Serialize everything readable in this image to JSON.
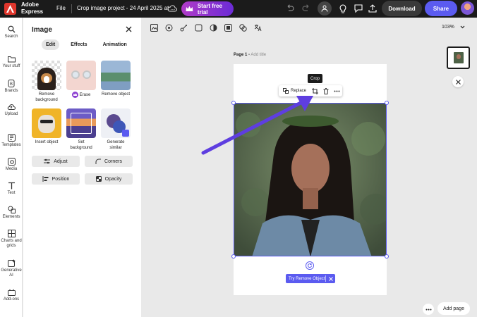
{
  "app": {
    "brand_line1": "Adobe",
    "brand_line2": "Express"
  },
  "topbar": {
    "file": "File",
    "title": "Crop image project - 24 April 2025 at ...",
    "trial": "Start free trial",
    "download": "Download",
    "share": "Share"
  },
  "rail": [
    {
      "label": "Search",
      "icon": "search-icon"
    },
    {
      "label": "Your stuff",
      "icon": "folder-icon"
    },
    {
      "label": "Brands",
      "icon": "brand-icon"
    },
    {
      "label": "Upload",
      "icon": "upload-icon"
    },
    {
      "label": "Templates",
      "icon": "templates-icon"
    },
    {
      "label": "Media",
      "icon": "media-icon"
    },
    {
      "label": "Text",
      "icon": "text-icon"
    },
    {
      "label": "Elements",
      "icon": "elements-icon"
    },
    {
      "label": "Charts and",
      "label2": "grids",
      "icon": "charts-icon"
    },
    {
      "label": "Generative",
      "label2": "AI",
      "icon": "generative-ai-icon"
    },
    {
      "label": "Add-ons",
      "icon": "addons-icon"
    }
  ],
  "panel": {
    "title": "Image",
    "tabs": [
      "Edit",
      "Effects",
      "Animation"
    ],
    "tiles": [
      {
        "label": "Remove",
        "label2": "background"
      },
      {
        "label": "Erase"
      },
      {
        "label": "Remove object"
      },
      {
        "label": "Insert object"
      },
      {
        "label": "Set background"
      },
      {
        "label": "Generate similar"
      }
    ],
    "buttons": [
      "Adjust",
      "Corners",
      "Position",
      "Opacity"
    ]
  },
  "canvas": {
    "zoom": "103%",
    "page_label": "Page 1 -",
    "add_title": "Add title",
    "crop_tooltip": "Crop",
    "replace": "Replace",
    "try_remove": "Try Remove Object",
    "add_page": "Add page"
  },
  "colors": {
    "accent": "#5b5bf0",
    "topbar": "#1b1b1b"
  }
}
